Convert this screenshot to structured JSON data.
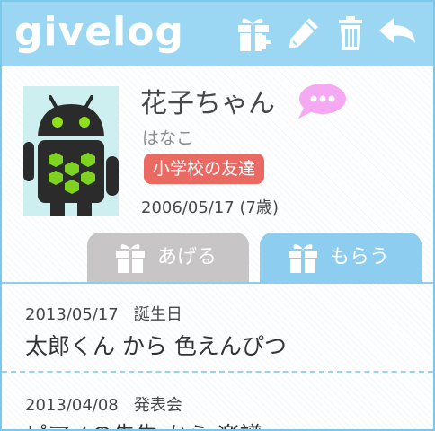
{
  "app": {
    "title": "givelog"
  },
  "toolbar": {
    "add_gift": "gift-plus-icon",
    "edit": "pen-icon",
    "delete": "trash-icon",
    "back": "back-arrow-icon"
  },
  "profile": {
    "name": "花子ちゃん",
    "kana": "はなこ",
    "tag": "小学校の友達",
    "birthday": "2006/05/17 (7歳)"
  },
  "tabs": [
    {
      "label": "あげる",
      "icon": "gift-icon",
      "active": false
    },
    {
      "label": "もらう",
      "icon": "gift-icon",
      "active": true
    }
  ],
  "entries": [
    {
      "date": "2013/05/17",
      "occasion": "誕生日",
      "text": "太郎くん から 色えんぴつ"
    },
    {
      "date": "2013/04/08",
      "occasion": "発表会",
      "text": "ピアノの先生 から 楽譜"
    }
  ],
  "colors": {
    "header": "#9bd7f3",
    "tag": "#ea6a63",
    "tab_inactive": "#c7c5c6",
    "tab_active": "#8dcdf0",
    "bubble": "#f5a9f2"
  }
}
